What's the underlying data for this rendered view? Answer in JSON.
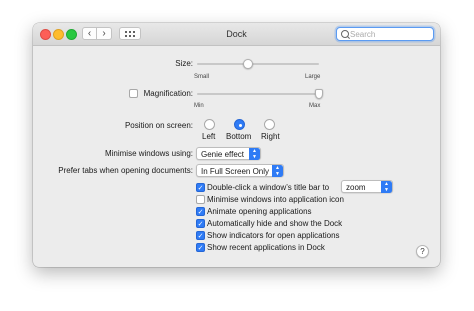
{
  "window": {
    "title": "Dock",
    "search": {
      "placeholder": "Search",
      "value": ""
    }
  },
  "toolbar": {
    "back_icon": "‹",
    "forward_icon": "›",
    "grid_icon": "grid-icon"
  },
  "size": {
    "label": "Size:",
    "min_label": "Small",
    "max_label": "Large",
    "level": 0.42
  },
  "magnification": {
    "label": "Magnification:",
    "checked": false,
    "min_label": "Min",
    "max_label": "Max",
    "level": 1.0
  },
  "position": {
    "label": "Position on screen:",
    "options": [
      "Left",
      "Bottom",
      "Right"
    ],
    "selected": "Bottom"
  },
  "minimise": {
    "label": "Minimise windows using:",
    "value": "Genie effect"
  },
  "tabs": {
    "label": "Prefer tabs when opening documents:",
    "value": "In Full Screen Only"
  },
  "options": [
    {
      "label": "Double-click a window’s title bar to",
      "checked": true,
      "popup": "zoom"
    },
    {
      "label": "Minimise windows into application icon",
      "checked": false
    },
    {
      "label": "Animate opening applications",
      "checked": true
    },
    {
      "label": "Automatically hide and show the Dock",
      "checked": true
    },
    {
      "label": "Show indicators for open applications",
      "checked": true
    },
    {
      "label": "Show recent applications in Dock",
      "checked": true
    }
  ],
  "help": "?",
  "colors": {
    "accent": "#2f7bf5",
    "window_bg": "#ececec"
  }
}
